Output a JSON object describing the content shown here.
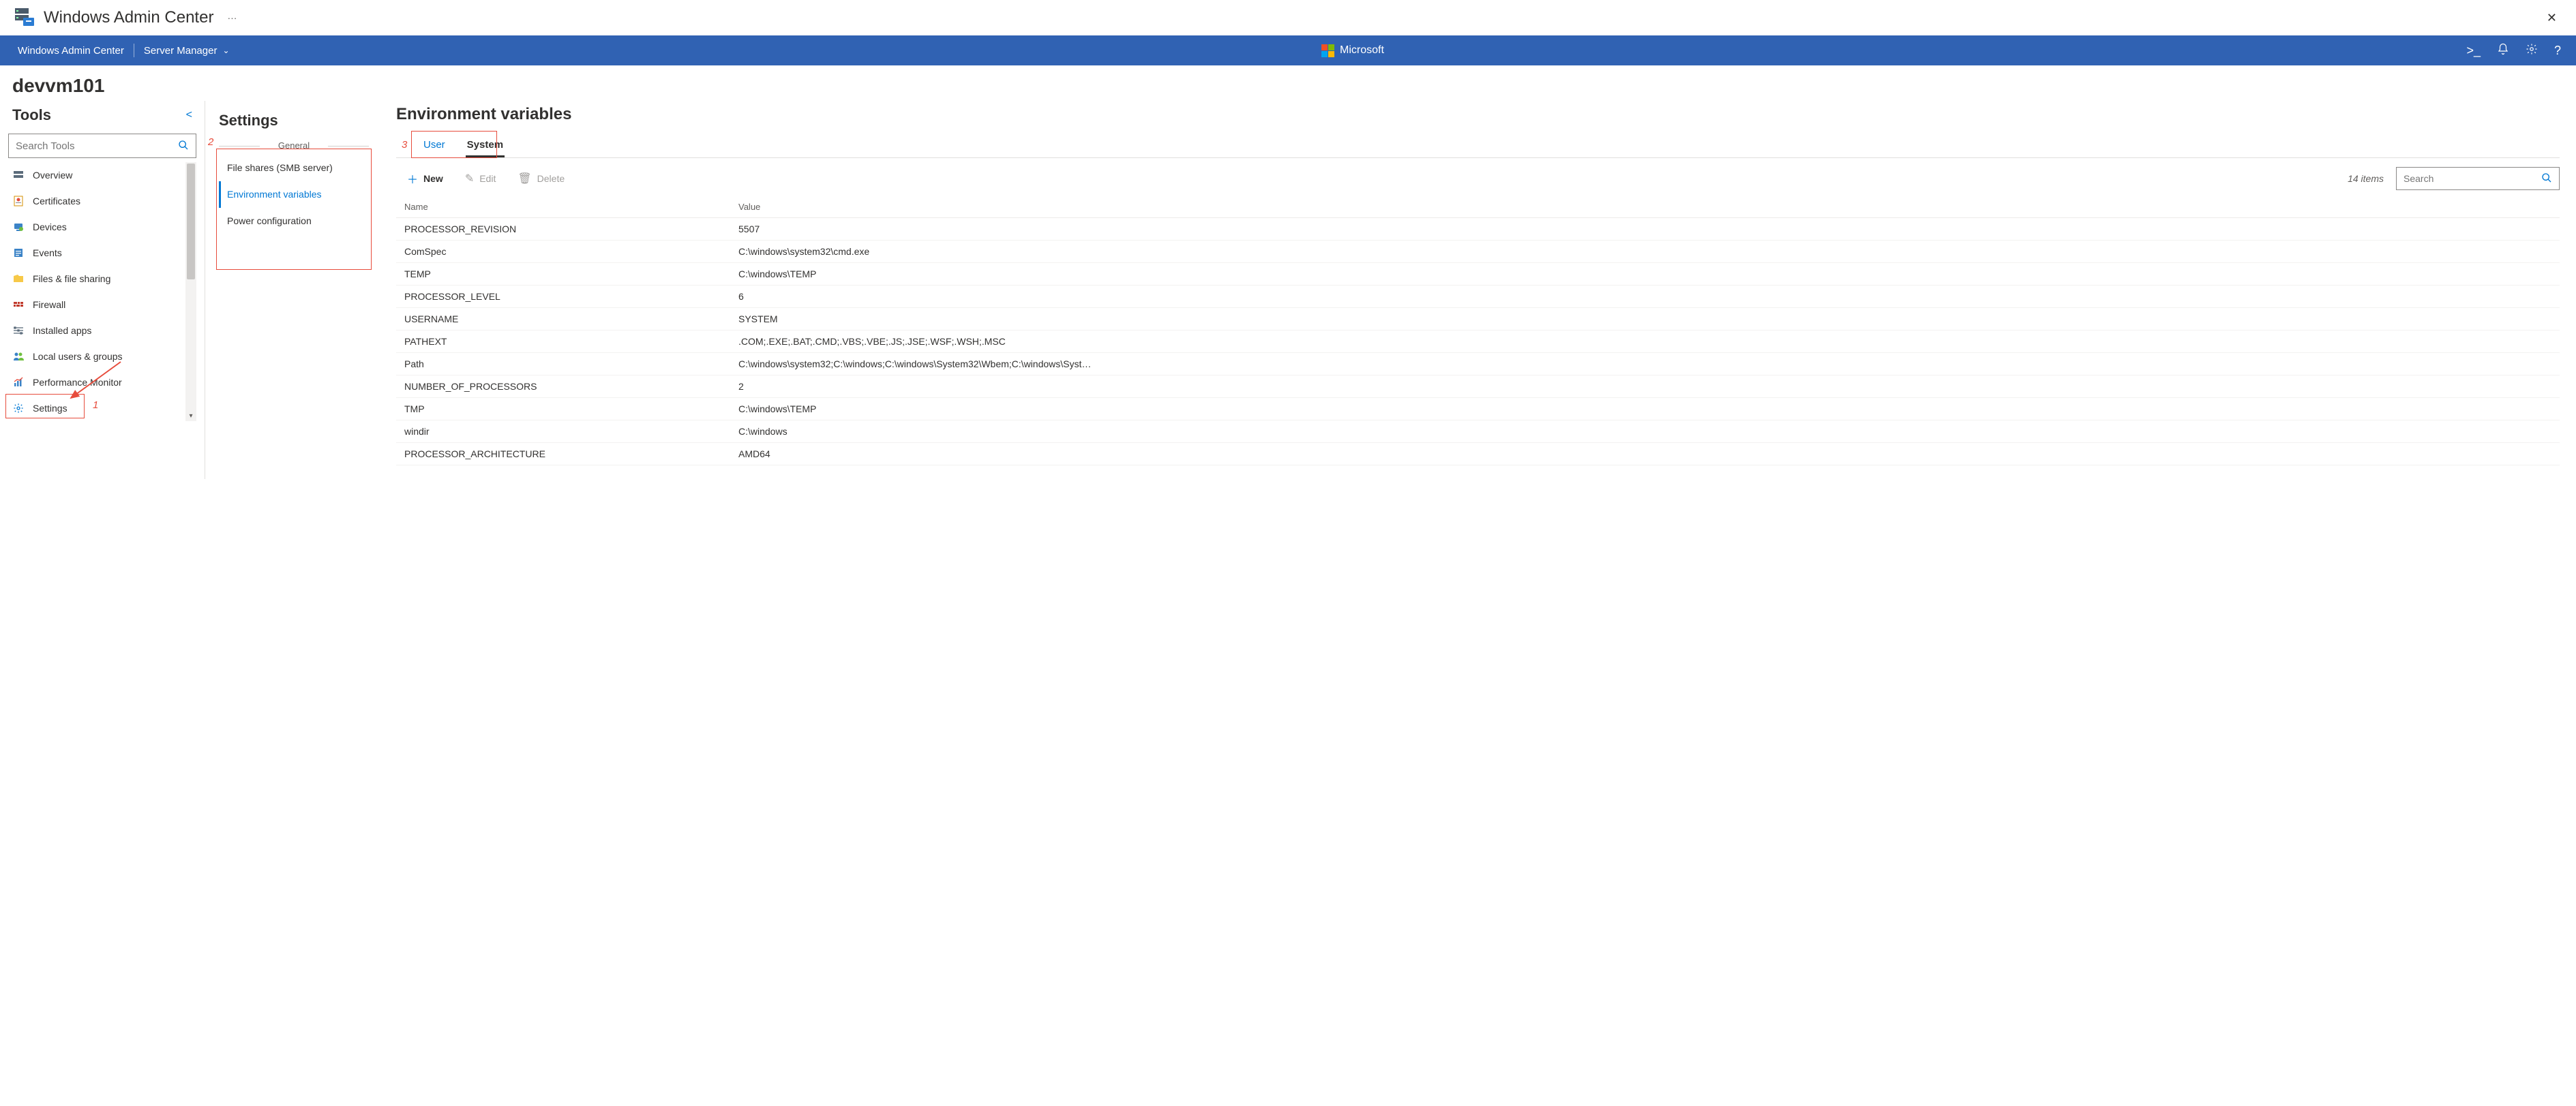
{
  "app": {
    "title": "Windows Admin Center",
    "more": "···"
  },
  "topnav": {
    "home": "Windows Admin Center",
    "context": "Server Manager",
    "brand": "Microsoft"
  },
  "host": "devvm101",
  "tools": {
    "heading": "Tools",
    "search_placeholder": "Search Tools",
    "items": [
      {
        "label": "Overview"
      },
      {
        "label": "Certificates"
      },
      {
        "label": "Devices"
      },
      {
        "label": "Events"
      },
      {
        "label": "Files & file sharing"
      },
      {
        "label": "Firewall"
      },
      {
        "label": "Installed apps"
      },
      {
        "label": "Local users & groups"
      },
      {
        "label": "Performance Monitor"
      },
      {
        "label": "Settings"
      }
    ]
  },
  "settings": {
    "heading": "Settings",
    "group": "General",
    "items": [
      {
        "label": "File shares (SMB server)"
      },
      {
        "label": "Environment variables"
      },
      {
        "label": "Power configuration"
      }
    ]
  },
  "main": {
    "title": "Environment variables",
    "tabs": {
      "user": "User",
      "system": "System"
    },
    "cmds": {
      "new": "New",
      "edit": "Edit",
      "delete": "Delete"
    },
    "count": "14 items",
    "search_placeholder": "Search",
    "cols": {
      "name": "Name",
      "value": "Value"
    },
    "rows": [
      {
        "n": "PROCESSOR_REVISION",
        "v": "5507"
      },
      {
        "n": "ComSpec",
        "v": "C:\\windows\\system32\\cmd.exe"
      },
      {
        "n": "TEMP",
        "v": "C:\\windows\\TEMP"
      },
      {
        "n": "PROCESSOR_LEVEL",
        "v": "6"
      },
      {
        "n": "USERNAME",
        "v": "SYSTEM"
      },
      {
        "n": "PATHEXT",
        "v": ".COM;.EXE;.BAT;.CMD;.VBS;.VBE;.JS;.JSE;.WSF;.WSH;.MSC"
      },
      {
        "n": "Path",
        "v": "C:\\windows\\system32;C:\\windows;C:\\windows\\System32\\Wbem;C:\\windows\\Syst…"
      },
      {
        "n": "NUMBER_OF_PROCESSORS",
        "v": "2"
      },
      {
        "n": "TMP",
        "v": "C:\\windows\\TEMP"
      },
      {
        "n": "windir",
        "v": "C:\\windows"
      },
      {
        "n": "PROCESSOR_ARCHITECTURE",
        "v": "AMD64"
      }
    ]
  },
  "callouts": {
    "c1": "1",
    "c2": "2",
    "c3": "3"
  }
}
